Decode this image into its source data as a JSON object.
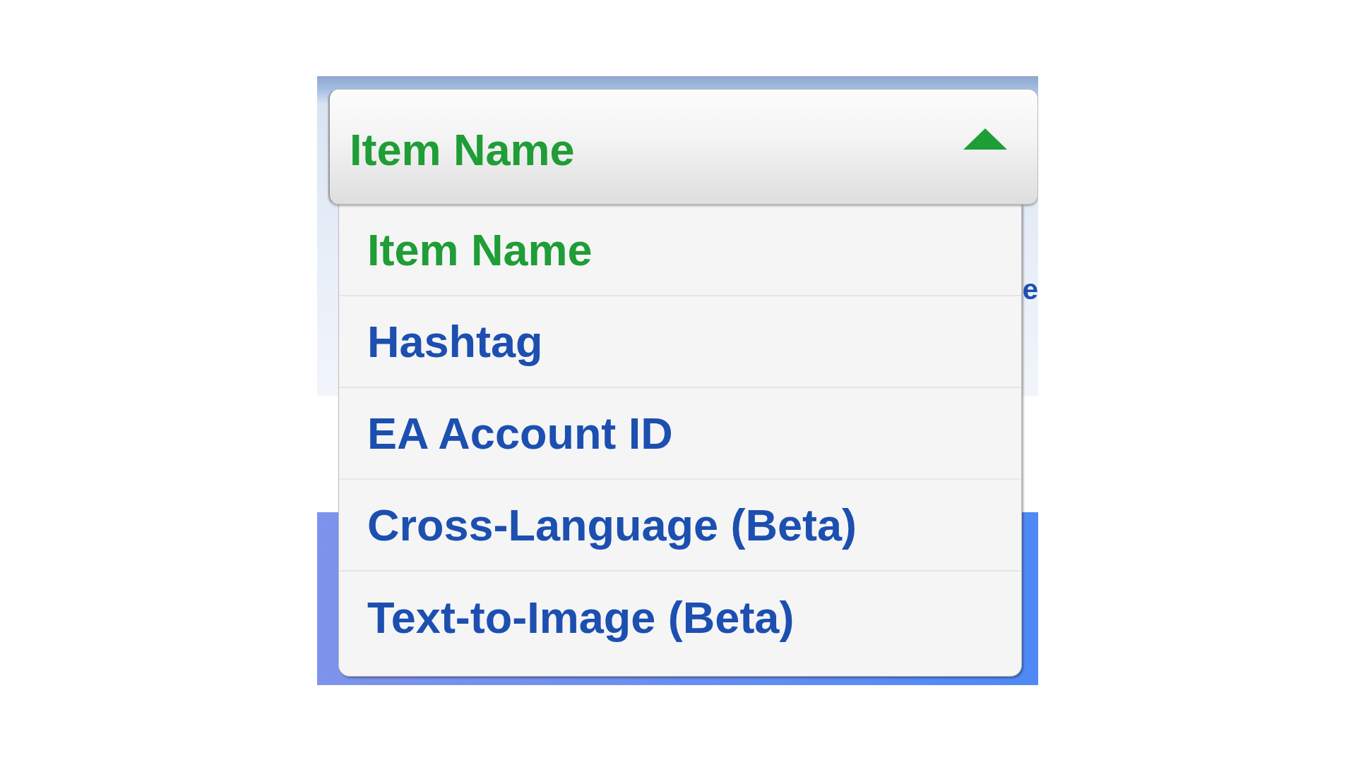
{
  "background": {
    "text_fragment": "e"
  },
  "dropdown": {
    "value": "Item Name",
    "expanded": true,
    "options": [
      {
        "label": "Item Name",
        "selected": true
      },
      {
        "label": "Hashtag",
        "selected": false
      },
      {
        "label": "EA Account ID",
        "selected": false
      },
      {
        "label": "Cross-Language (Beta)",
        "selected": false
      },
      {
        "label": "Text-to-Image (Beta)",
        "selected": false
      }
    ]
  }
}
